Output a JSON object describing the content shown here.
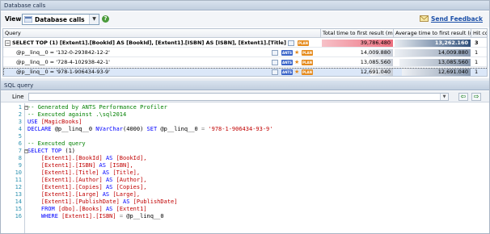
{
  "window": {
    "title": "Database calls"
  },
  "toolbar": {
    "view_label": "View:",
    "view_value": "Database calls",
    "help_glyph": "?",
    "send_feedback": "Send Feedback"
  },
  "grid": {
    "columns": [
      "Query",
      "Total time to first result (ms)",
      "Average time to first result (ms)",
      "Hit count"
    ],
    "rows": [
      {
        "query": "SELECT TOP (1)  [Extent1].[BookId] AS [BookId],  [Extent1].[ISBN] AS [ISBN],  [Extent1].[Title] AS [Title], ...",
        "total": "39,786.480",
        "avg": "13,262.160",
        "hits": "3",
        "total_fraction": 1.0,
        "avg_fraction": 1.0
      },
      {
        "query": "@p__linq__0 = '132-0-293842-12-2'",
        "total": "14,009.880",
        "avg": "14,009.880",
        "hits": "1",
        "total_fraction": 0.352,
        "avg_fraction": 1.0
      },
      {
        "query": "@p__linq__0 = '728-4-102938-42-1'",
        "total": "13,085.560",
        "avg": "13,085.560",
        "hits": "1",
        "total_fraction": 0.329,
        "avg_fraction": 0.934
      },
      {
        "query": "@p__linq__0 = '978-1-906434-93-9'",
        "total": "12,691.040",
        "avg": "12,691.040",
        "hits": "1",
        "total_fraction": 0.319,
        "avg_fraction": 0.906
      }
    ],
    "badge_ants": "ANTS",
    "badge_plan": "PLAN"
  },
  "sql": {
    "title": "SQL query",
    "line_label": "Line",
    "nav_back": "⇦",
    "nav_forward": "⇨",
    "lines": [
      [
        {
          "t": "-- Generated by ANTS Performance Profiler",
          "c": "c-comment"
        }
      ],
      [
        {
          "t": "-- Executed against .\\sql2014",
          "c": "c-comment"
        }
      ],
      [
        {
          "t": "USE ",
          "c": "c-kw"
        },
        {
          "t": "[MagicBooks]",
          "c": "c-id"
        }
      ],
      [
        {
          "t": "DECLARE ",
          "c": "c-kw"
        },
        {
          "t": "@p__linq__0 ",
          "c": "c-plain"
        },
        {
          "t": "NVarChar",
          "c": "c-kw"
        },
        {
          "t": "(4000) ",
          "c": "c-plain"
        },
        {
          "t": "SET ",
          "c": "c-kw"
        },
        {
          "t": "@p__linq__0 ",
          "c": "c-plain"
        },
        {
          "t": "= ",
          "c": "c-op"
        },
        {
          "t": "'978-1-906434-93-9'",
          "c": "c-str"
        }
      ],
      [
        {
          "t": "",
          "c": "c-plain"
        }
      ],
      [
        {
          "t": "-- Executed query",
          "c": "c-comment"
        }
      ],
      [
        {
          "t": "SELECT TOP ",
          "c": "c-kw"
        },
        {
          "t": "(1)",
          "c": "c-plain"
        }
      ],
      [
        {
          "t": "    [Extent1].[BookId] ",
          "c": "c-id"
        },
        {
          "t": "AS ",
          "c": "c-kw"
        },
        {
          "t": "[BookId],",
          "c": "c-id"
        }
      ],
      [
        {
          "t": "    [Extent1].[ISBN] ",
          "c": "c-id"
        },
        {
          "t": "AS ",
          "c": "c-kw"
        },
        {
          "t": "[ISBN],",
          "c": "c-id"
        }
      ],
      [
        {
          "t": "    [Extent1].[Title] ",
          "c": "c-id"
        },
        {
          "t": "AS ",
          "c": "c-kw"
        },
        {
          "t": "[Title],",
          "c": "c-id"
        }
      ],
      [
        {
          "t": "    [Extent1].[Author] ",
          "c": "c-id"
        },
        {
          "t": "AS ",
          "c": "c-kw"
        },
        {
          "t": "[Author],",
          "c": "c-id"
        }
      ],
      [
        {
          "t": "    [Extent1].[Copies] ",
          "c": "c-id"
        },
        {
          "t": "AS ",
          "c": "c-kw"
        },
        {
          "t": "[Copies],",
          "c": "c-id"
        }
      ],
      [
        {
          "t": "    [Extent1].[Large] ",
          "c": "c-id"
        },
        {
          "t": "AS ",
          "c": "c-kw"
        },
        {
          "t": "[Large],",
          "c": "c-id"
        }
      ],
      [
        {
          "t": "    [Extent1].[PublishDate] ",
          "c": "c-id"
        },
        {
          "t": "AS ",
          "c": "c-kw"
        },
        {
          "t": "[PublishDate]",
          "c": "c-id"
        }
      ],
      [
        {
          "t": "    FROM ",
          "c": "c-kw"
        },
        {
          "t": "[dbo].[Books] ",
          "c": "c-id"
        },
        {
          "t": "AS ",
          "c": "c-kw"
        },
        {
          "t": "[Extent1]",
          "c": "c-id"
        }
      ],
      [
        {
          "t": "    WHERE ",
          "c": "c-kw"
        },
        {
          "t": "[Extent1].[ISBN] ",
          "c": "c-id"
        },
        {
          "t": "= ",
          "c": "c-op"
        },
        {
          "t": "@p__linq__0",
          "c": "c-plain"
        }
      ]
    ]
  },
  "colors": {
    "total_bar_top": "#ec6f7f",
    "avg_bar_dark": "#2f4f7a",
    "comment": "#008000",
    "keyword": "#0000ff",
    "identifier": "#c00000"
  }
}
